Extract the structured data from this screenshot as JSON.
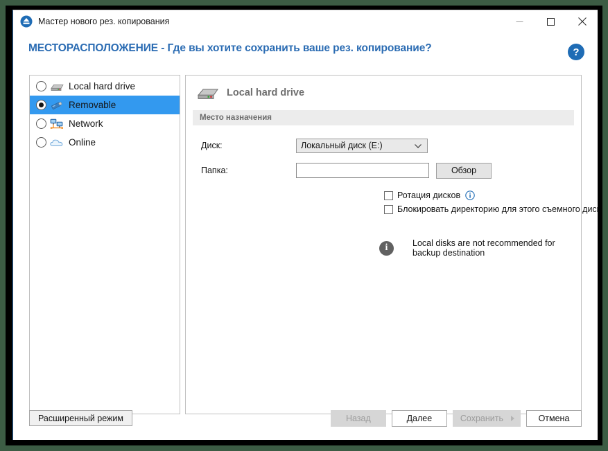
{
  "window": {
    "title": "Мастер нового рез. копирования",
    "app_icon": "eject-circle-icon",
    "minimize_label": "—",
    "maximize_label": "□",
    "close_label": "✕"
  },
  "header": {
    "title": "МЕСТОРАСПОЛОЖЕНИЕ - Где вы хотите сохранить ваше рез. копирование?",
    "help_label": "?",
    "accent_color": "#2b6cb3"
  },
  "sidebar": {
    "items": [
      {
        "label": "Local hard drive",
        "icon": "hard-drive-icon",
        "selected": false
      },
      {
        "label": "Removable",
        "icon": "usb-drive-icon",
        "selected": true
      },
      {
        "label": "Network",
        "icon": "network-icon",
        "selected": false
      },
      {
        "label": "Online",
        "icon": "cloud-icon",
        "selected": false
      }
    ],
    "selected_color": "#3399ef"
  },
  "panel": {
    "title": "Local hard drive",
    "icon": "hard-drive-icon",
    "section_title": "Место назначения",
    "fields": {
      "disk_label": "Диск:",
      "disk_value": "Локальный диск (E:)",
      "folder_label": "Папка:",
      "folder_value": "",
      "folder_placeholder": "",
      "browse_label": "Обзор"
    },
    "checkboxes": [
      {
        "label": "Ротация дисков",
        "checked": false,
        "info": true
      },
      {
        "label": "Блокировать директорию для этого съемного диска",
        "checked": false,
        "info": false
      }
    ],
    "notice": {
      "icon": "info-icon",
      "text": "Local disks are not recommended for backup destination"
    }
  },
  "footer": {
    "advanced_label": "Расширенный режим",
    "back_label": "Назад",
    "next_label": "Далее",
    "save_label": "Сохранить",
    "cancel_label": "Отмена"
  }
}
